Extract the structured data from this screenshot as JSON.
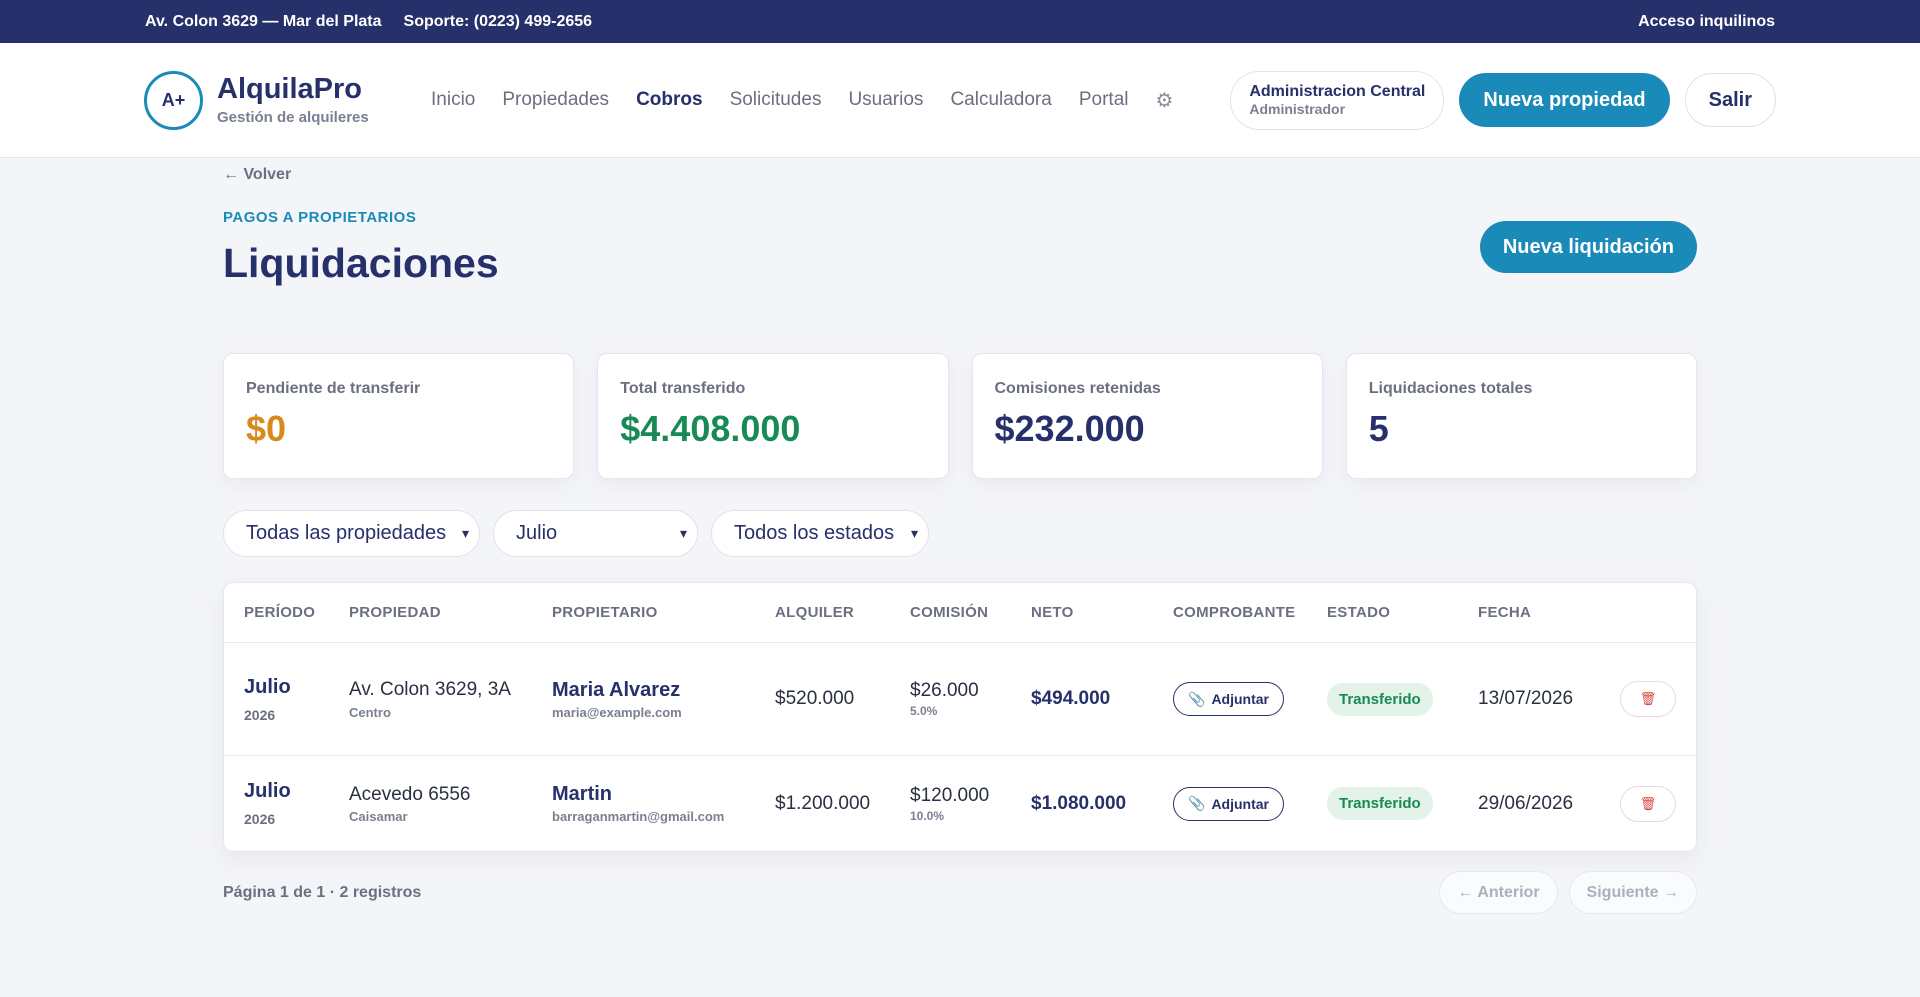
{
  "topbar": {
    "address": "Av. Colon 3629 — Mar del Plata",
    "support": "Soporte: (0223) 499-2656",
    "tenant_access": "Acceso inquilinos"
  },
  "brand": {
    "logo_text": "A+",
    "name": "AlquilaPro",
    "subtitle": "Gestión de alquileres"
  },
  "nav": {
    "items": [
      "Inicio",
      "Propiedades",
      "Cobros",
      "Solicitudes",
      "Usuarios",
      "Calculadora",
      "Portal"
    ],
    "active": "Cobros",
    "settings_icon": "gear-icon"
  },
  "user": {
    "name": "Administracion Central",
    "role": "Administrador"
  },
  "header_actions": {
    "new_property": "Nueva propiedad",
    "logout": "Salir"
  },
  "page": {
    "back": "← Volver",
    "eyebrow": "PAGOS A PROPIETARIOS",
    "title": "Liquidaciones",
    "new_button": "Nueva liquidación"
  },
  "stats": [
    {
      "label": "Pendiente de transferir",
      "value": "$0",
      "color": "#d88a1b"
    },
    {
      "label": "Total transferido",
      "value": "$4.408.000",
      "color": "#178a55"
    },
    {
      "label": "Comisiones retenidas",
      "value": "$232.000",
      "color": "#26306b"
    },
    {
      "label": "Liquidaciones totales",
      "value": "5",
      "color": "#26306b"
    }
  ],
  "filters": {
    "property": "Todas las propiedades",
    "month": "Julio",
    "status": "Todos los estados"
  },
  "table": {
    "columns": [
      "PERÍODO",
      "PROPIEDAD",
      "PROPIETARIO",
      "ALQUILER",
      "COMISIÓN",
      "NETO",
      "COMPROBANTE",
      "ESTADO",
      "FECHA"
    ],
    "attach_label": "Adjuntar",
    "rows": [
      {
        "month": "Julio",
        "year": "2026",
        "property": "Av. Colon 3629, 3A",
        "zone": "Centro",
        "owner": "Maria Alvarez",
        "email": "maria@example.com",
        "rent": "$520.000",
        "commission": "$26.000",
        "commission_pct": "5.0%",
        "net": "$494.000",
        "status": "Transferido",
        "date": "13/07/2026"
      },
      {
        "month": "Julio",
        "year": "2026",
        "property": "Acevedo 6556",
        "zone": "Caisamar",
        "owner": "Martin",
        "email": "barraganmartin@gmail.com",
        "rent": "$1.200.000",
        "commission": "$120.000",
        "commission_pct": "10.0%",
        "net": "$1.080.000",
        "status": "Transferido",
        "date": "29/06/2026"
      }
    ]
  },
  "pagination": {
    "info": "Página 1 de 1 · 2 registros",
    "prev": "← Anterior",
    "next": "Siguiente →"
  },
  "colors": {
    "topbar": "#26306b",
    "accent": "#1a8ab8",
    "success": "#178a55",
    "warning": "#d88a1b",
    "danger": "#d94545"
  }
}
